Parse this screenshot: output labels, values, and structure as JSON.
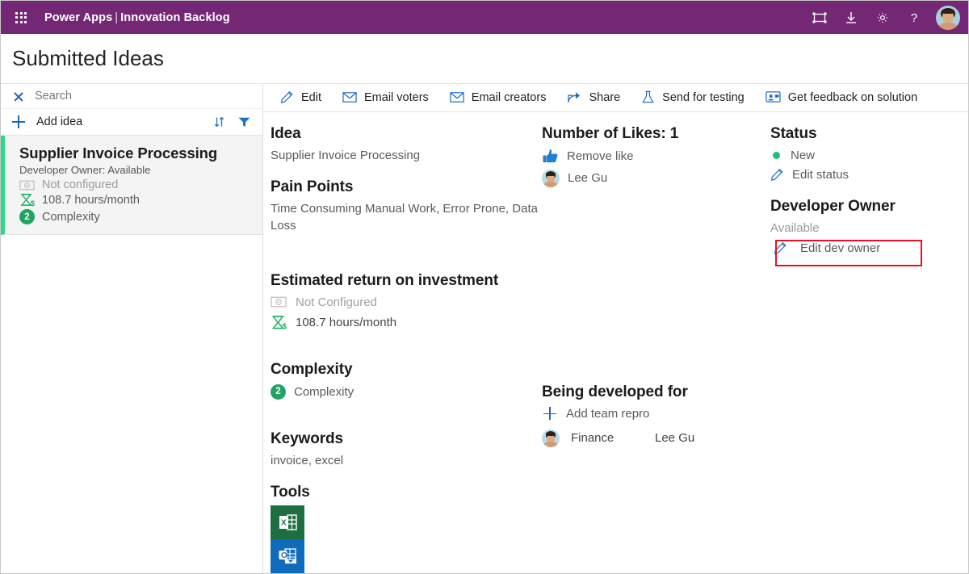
{
  "topbar": {
    "waffle_label": "App launcher",
    "brand_app": "Power Apps",
    "brand_sep": "|",
    "brand_page": "Innovation Backlog",
    "icons": [
      "fit-screen-icon",
      "download-icon",
      "gear-icon",
      "help-icon"
    ],
    "avatar_label": "User account"
  },
  "page": {
    "title": "Submitted Ideas"
  },
  "sidebar": {
    "search": {
      "value": "",
      "placeholder": "Search",
      "clear_label": "Clear search"
    },
    "add_idea_label": "Add idea",
    "sort_label": "Sort",
    "filter_label": "Filter",
    "cards": [
      {
        "title": "Supplier Invoice Processing",
        "owner": "Developer Owner: Available",
        "roi_money": "Not configured",
        "roi_hours": "108.7 hours/month",
        "complexity_badge": "2",
        "complexity_label": "Complexity"
      }
    ]
  },
  "commandbar": {
    "items": [
      {
        "label": "Edit",
        "icon": "pencil-icon"
      },
      {
        "label": "Email voters",
        "icon": "envelope-icon"
      },
      {
        "label": "Email creators",
        "icon": "envelope-icon"
      },
      {
        "label": "Share",
        "icon": "share-icon"
      },
      {
        "label": "Send for testing",
        "icon": "flask-icon"
      },
      {
        "label": "Get feedback on solution",
        "icon": "feedback-person-icon"
      }
    ]
  },
  "detail": {
    "idea": {
      "heading": "Idea",
      "value": "Supplier Invoice Processing"
    },
    "pain_points": {
      "heading": "Pain Points",
      "value": "Time Consuming Manual Work, Error Prone, Data Loss"
    },
    "roi": {
      "heading": "Estimated return on investment",
      "money_value": "Not Configured",
      "hours_value": "108.7 hours/month"
    },
    "complexity": {
      "heading": "Complexity",
      "badge": "2",
      "value": "Complexity"
    },
    "keywords": {
      "heading": "Keywords",
      "value": "invoice, excel"
    },
    "tools": {
      "heading": "Tools",
      "items": [
        "excel-icon",
        "outlook-icon"
      ]
    },
    "likes": {
      "heading": "Number of Likes: 1",
      "action_label": "Remove like",
      "voters": [
        "Lee Gu"
      ]
    },
    "developed_for": {
      "heading": "Being developed for",
      "add_label": "Add team repro",
      "rows": [
        {
          "team": "Finance",
          "person": "Lee Gu"
        }
      ]
    },
    "status": {
      "heading": "Status",
      "value": "New",
      "edit_label": "Edit status",
      "dot_color": "#19c37d"
    },
    "developer_owner": {
      "heading": "Developer Owner",
      "value": "Available",
      "edit_label": "Edit dev owner"
    }
  },
  "annotation": {
    "highlight_color": "#e81123",
    "target": "edit-dev-owner-link"
  }
}
